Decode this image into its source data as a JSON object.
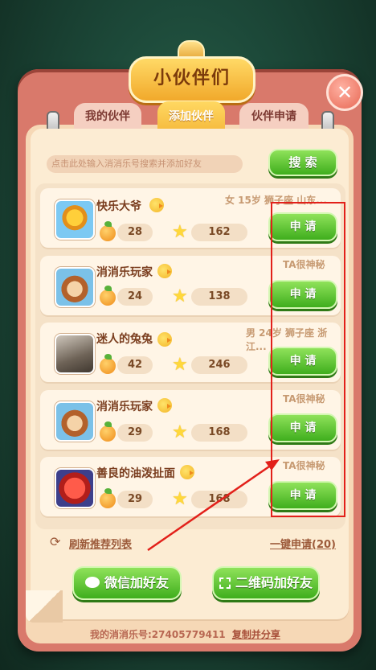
{
  "title": "小伙伴们",
  "close_icon": "close-icon",
  "tabs": [
    {
      "label": "我的伙伴",
      "active": false
    },
    {
      "label": "添加伙伴",
      "active": true
    },
    {
      "label": "伙伴申请",
      "active": false
    }
  ],
  "search": {
    "placeholder": "点击此处输入消消乐号搜索并添加好友",
    "button": "搜 索"
  },
  "friends": [
    {
      "name": "快乐大爷",
      "info": "女 15岁 狮子座 山东...",
      "fruit": "28",
      "star": "162",
      "action": "申 请",
      "avatar": "sunflower-avatar"
    },
    {
      "name": "消消乐玩家",
      "info": "TA很神秘",
      "fruit": "24",
      "star": "138",
      "action": "申 请",
      "avatar": "raccoon-avatar"
    },
    {
      "name": "迷人的兔兔",
      "info": "男 24岁 狮子座 浙江...",
      "fruit": "42",
      "star": "246",
      "action": "申 请",
      "avatar": "photo-avatar"
    },
    {
      "name": "消消乐玩家",
      "info": "TA很神秘",
      "fruit": "29",
      "star": "168",
      "action": "申 请",
      "avatar": "raccoon-avatar"
    },
    {
      "name": "善良的油泼扯面",
      "info": "TA很神秘",
      "fruit": "29",
      "star": "168",
      "action": "申 请",
      "avatar": "red-monster-avatar"
    }
  ],
  "refresh": "刷新推荐列表",
  "apply_all": "一键申请(20)",
  "wechat_button": "微信加好友",
  "qr_button": "二维码加好友",
  "footer": {
    "label": "我的消消乐号:27405779411",
    "copy": "复制并分享"
  },
  "colors": {
    "annotation_red": "#e2201a",
    "green_button": "#3fae1d",
    "panel": "#d9796b"
  }
}
